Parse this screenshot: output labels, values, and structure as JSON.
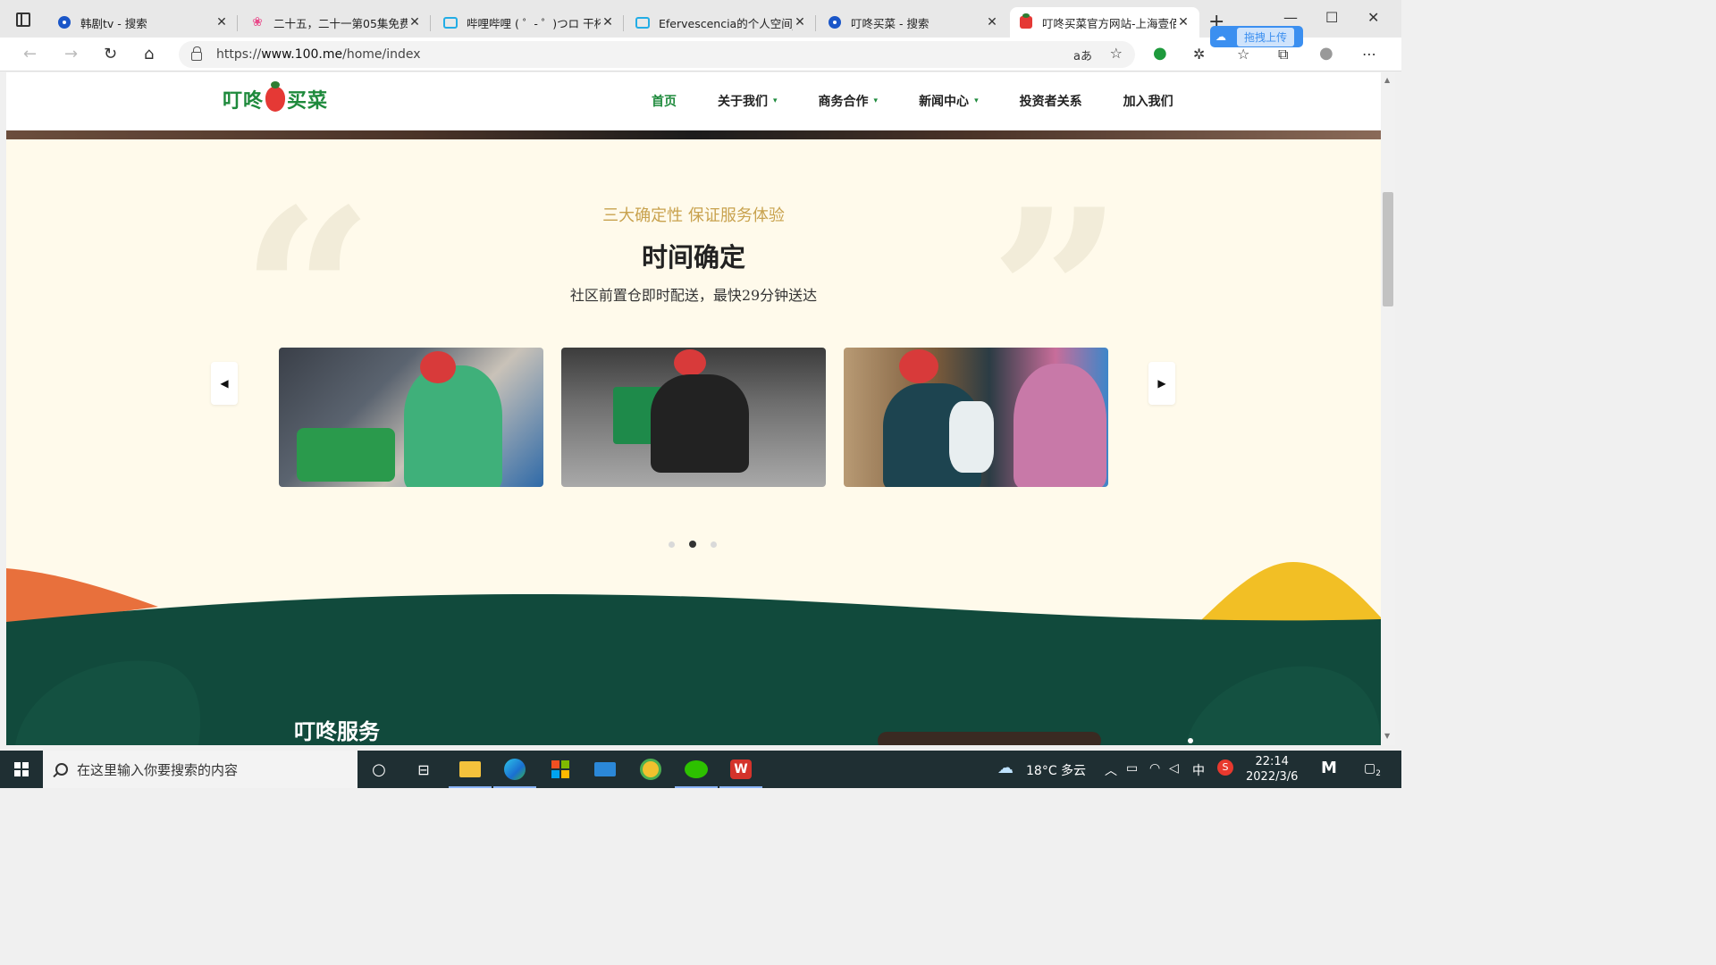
{
  "browser": {
    "tabs": [
      {
        "title": "韩剧tv - 搜索",
        "icon": "search-icon"
      },
      {
        "title": "二十五，二十一第05集免费",
        "icon": "flower-icon"
      },
      {
        "title": "哔哩哔哩 ( ゜- ゜)つロ 干杯~",
        "icon": "bilibili-icon"
      },
      {
        "title": "Efervescencia的个人空间_哔",
        "icon": "bilibili-icon"
      },
      {
        "title": "叮咚买菜 - 搜索",
        "icon": "search-icon"
      },
      {
        "title": "叮咚买菜官方网站-上海壹佰",
        "icon": "dingdong-icon",
        "active": true
      }
    ],
    "upload_badge": "拖拽上传",
    "url_prefix": "https://",
    "url_host": "www.100.me",
    "url_path": "/home/index",
    "translate_label": "aあ"
  },
  "site": {
    "logo_text_left": "叮咚",
    "logo_text_right": "买菜",
    "nav": [
      {
        "label": "首页",
        "active": true,
        "dropdown": false
      },
      {
        "label": "关于我们",
        "dropdown": true
      },
      {
        "label": "商务合作",
        "dropdown": true
      },
      {
        "label": "新闻中心",
        "dropdown": true
      },
      {
        "label": "投资者关系",
        "dropdown": false
      },
      {
        "label": "加入我们",
        "dropdown": false
      }
    ],
    "section": {
      "kicker": "三大确定性 保证服务体验",
      "title": "时间确定",
      "description": "社区前置仓即时配送，最快29分钟送达"
    },
    "carousel": {
      "slides": 3,
      "active_index": 1
    },
    "service_title": "叮咚服务"
  },
  "taskbar": {
    "search_placeholder": "在这里输入你要搜索的内容",
    "weather": "18°C  多云",
    "ime": "中",
    "time": "22:14",
    "date": "2022/3/6",
    "notifications": "2"
  },
  "colors": {
    "brand_green": "#1e8a3c",
    "gold": "#c8a24e",
    "deep_green": "#114a3c",
    "orange": "#e8703c",
    "yellow": "#f2bf25",
    "page_bg": "#fffaeb"
  }
}
